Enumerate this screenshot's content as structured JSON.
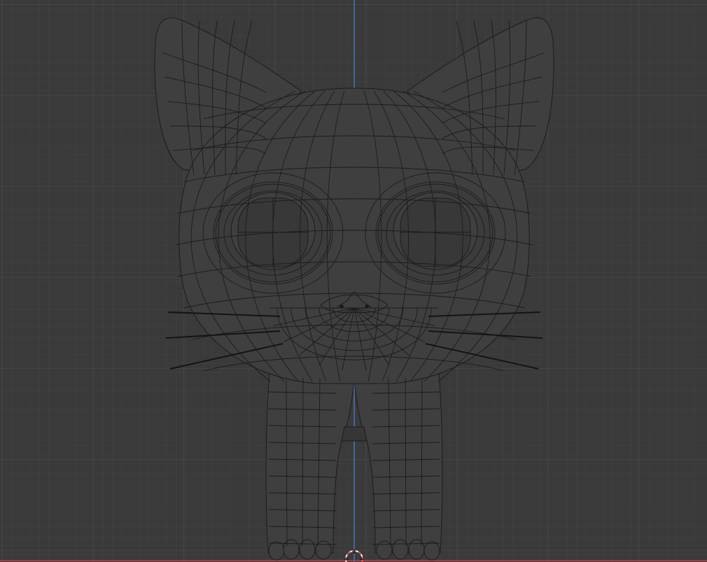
{
  "viewport": {
    "background": "#3a3a3a",
    "grid_minor_color": "#424242",
    "grid_major_color": "#4a4a4a",
    "axis_z_color": "#5680c2",
    "axis_x_color": "#c0504d"
  },
  "model": {
    "fill": "#3f3f3f",
    "wire": "#1c1c1c",
    "whisker": "#141414"
  },
  "cursor_3d": {
    "ring_color_a": "#e05050",
    "ring_color_b": "#f0f0f0"
  },
  "icons": {
    "cursor": "3d-cursor-icon"
  }
}
